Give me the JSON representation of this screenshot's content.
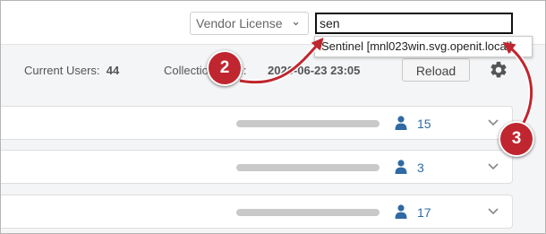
{
  "header": {
    "vendor_select": {
      "selected": "Vendor License",
      "icon": "chevron-down-icon"
    },
    "search": {
      "value": "sen"
    },
    "suggestion": {
      "label": "Sentinel [mnl023win.svg.openit.local]"
    }
  },
  "toolbar": {
    "current_users_label": "Current Users:",
    "current_users_value": "44",
    "collection_label": "Collection Time:",
    "collection_value": "2020-06-23 23:05",
    "reload_label": "Reload",
    "settings_icon": "gear-icon"
  },
  "rows": [
    {
      "user_count": "15"
    },
    {
      "user_count": "3"
    },
    {
      "user_count": "17"
    }
  ],
  "callouts": [
    {
      "label": "2"
    },
    {
      "label": "3"
    }
  ],
  "colors": {
    "callout": "#c0262f",
    "link": "#2f6aa3",
    "placeholder_bar": "#c9c9c9",
    "background": "#f4f5f7"
  }
}
